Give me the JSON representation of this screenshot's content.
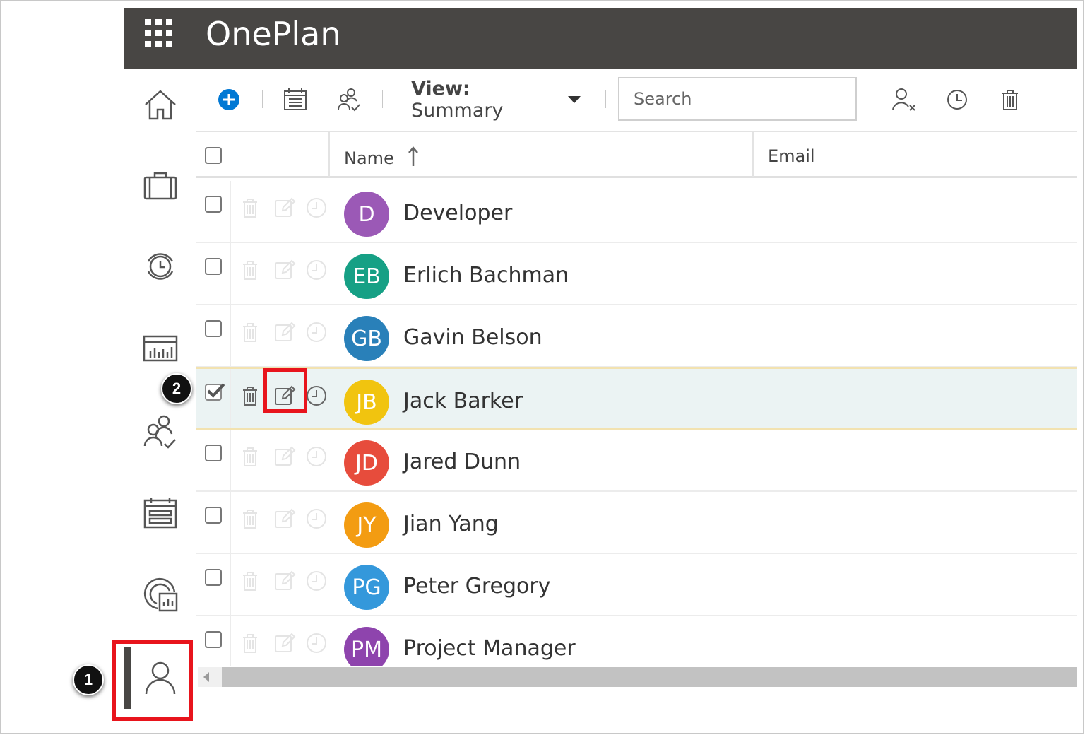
{
  "app": {
    "title": "OnePlan"
  },
  "nav": {
    "items": [
      {
        "name": "home-icon"
      },
      {
        "name": "briefcase-icon"
      },
      {
        "name": "timesheet-icon"
      },
      {
        "name": "report-icon"
      },
      {
        "name": "resource-assign-icon"
      },
      {
        "name": "calendar-icon"
      },
      {
        "name": "analytics-icon"
      },
      {
        "name": "user-icon",
        "active": true
      }
    ]
  },
  "toolbar": {
    "view_prefix": "View:",
    "view_value": "Summary",
    "search_placeholder": "Search"
  },
  "grid": {
    "columns": [
      "Name",
      "Email"
    ],
    "sort": "ascending",
    "rows": [
      {
        "initials": "D",
        "name": "Developer",
        "color": "#9b59b6",
        "selected": false
      },
      {
        "initials": "EB",
        "name": "Erlich Bachman",
        "color": "#16a085",
        "selected": false
      },
      {
        "initials": "GB",
        "name": "Gavin Belson",
        "color": "#2980b9",
        "selected": false
      },
      {
        "initials": "JB",
        "name": "Jack Barker",
        "color": "#f1c40f",
        "selected": true
      },
      {
        "initials": "JD",
        "name": "Jared Dunn",
        "color": "#e74c3c",
        "selected": false
      },
      {
        "initials": "JY",
        "name": "Jian Yang",
        "color": "#f39c12",
        "selected": false
      },
      {
        "initials": "PG",
        "name": "Peter Gregory",
        "color": "#3498db",
        "selected": false
      },
      {
        "initials": "PM",
        "name": "Project Manager",
        "color": "#8e44ad",
        "selected": false
      }
    ]
  },
  "annotations": {
    "step1": "1",
    "step2": "2"
  },
  "colors": {
    "topbar": "#484644",
    "accent": "#0078d4",
    "highlight": "#e8141c"
  }
}
